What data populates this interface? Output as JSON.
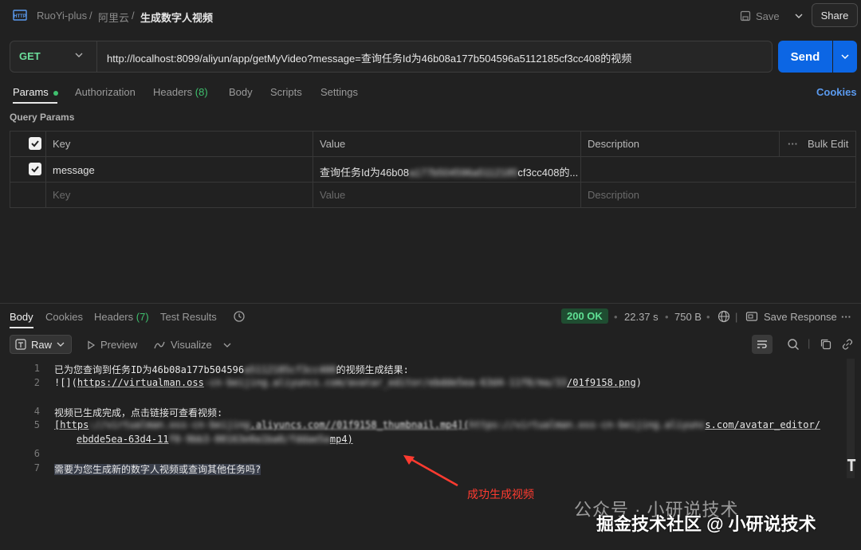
{
  "breadcrumb": {
    "workspace": "RuoYi-plus",
    "sep1": "/",
    "collection": "阿里云",
    "sep2": "/",
    "request": "生成数字人视频"
  },
  "header": {
    "save_label": "Save",
    "share_label": "Share"
  },
  "request": {
    "method": "GET",
    "url": "http://localhost:8099/aliyun/app/getMyVideo?message=查询任务Id为46b08a177b504596a5112185cf3cc408的视频",
    "send_label": "Send"
  },
  "request_tabs": {
    "params": "Params",
    "authorization": "Authorization",
    "headers": "Headers",
    "headers_count": "(8)",
    "body": "Body",
    "scripts": "Scripts",
    "settings": "Settings",
    "cookies": "Cookies"
  },
  "query_params": {
    "title": "Query Params",
    "columns": {
      "key": "Key",
      "value": "Value",
      "description": "Description",
      "bulk_edit": "Bulk Edit"
    },
    "rows": [
      {
        "key": "message",
        "value_start": "查询任务Id为46b08",
        "value_blurred": "a177b504596a5112185",
        "value_end": "cf3cc408的..."
      }
    ],
    "placeholders": {
      "key": "Key",
      "value": "Value",
      "description": "Description"
    }
  },
  "response_tabs": {
    "body": "Body",
    "cookies": "Cookies",
    "headers": "Headers",
    "headers_count": "(7)",
    "test_results": "Test Results"
  },
  "response_meta": {
    "status": "200 OK",
    "time": "22.37 s",
    "size": "750 B",
    "save_response": "Save Response"
  },
  "response_toolbar": {
    "raw": "Raw",
    "preview": "Preview",
    "visualize": "Visualize"
  },
  "code": {
    "line_numbers": [
      "1",
      "2",
      "",
      "4",
      "5",
      "",
      "6",
      "7"
    ],
    "line1_a": "已为您查询到任务ID为46b08a177b504596",
    "line1_blur": "a5112185cf3cc408",
    "line1_b": "的视频生成结果:",
    "line2_a": "![](",
    "line2_link": "https://virtualman.oss",
    "line2_blur": "-cn-beijing.aliyuncs.com/avatar_editor/ebdde5ea-63d4-11f0/ma/33",
    "line2_end": "/01f9158.png",
    "line2_close": ")",
    "line4": "视频已生成完成，点击链接可查看视频:",
    "line5_a": "[https",
    "line5_blur1": "://virtualman.oss-cn-beijing",
    "line5_mid": ".aliyuncs.com/",
    "line5_mid2": "/01f9158_thumbnail.mp4](",
    "line5_blur2": "https://virtualman.oss-cn-beijing.aliyunc",
    "line5_end": "s.com/avatar_editor/",
    "line5b_a": "ebdde5ea-63d4-11",
    "line5b_blur": "f0-9bb3-00163e0a1ba0/fddae5a",
    "line5b_end": "mp4)",
    "line7": "需要为您生成新的数字人视频或查询其他任务吗?"
  },
  "annotation": {
    "text": "成功生成视频",
    "color": "#ff3b30"
  },
  "watermark": {
    "line1": "公众号 · 小研说技术",
    "line2": "掘金技术社区 @ 小研说技术"
  }
}
